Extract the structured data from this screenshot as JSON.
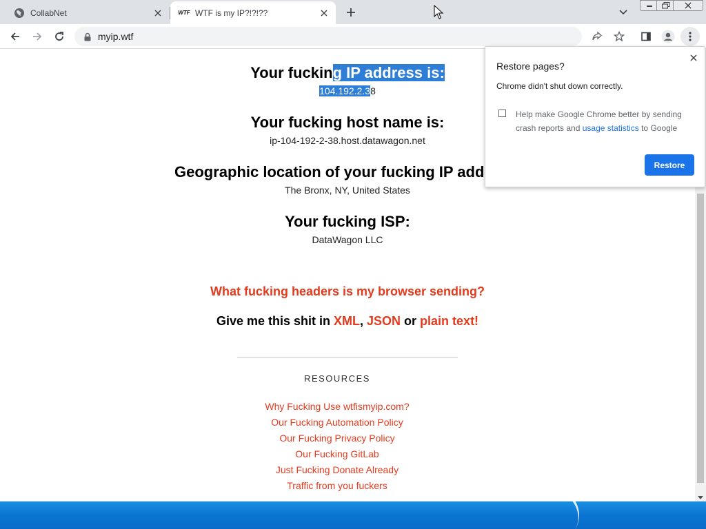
{
  "browser": {
    "tabs": [
      {
        "title": "CollabNet",
        "icon": "globe-icon"
      },
      {
        "title": "WTF is my IP?!?!??",
        "icon": "wtf-favicon",
        "favicon_text": "WTF"
      }
    ],
    "url": "myip.wtf"
  },
  "page": {
    "ip": {
      "heading_plain": "Your fuckin",
      "heading_selected": "g IP address is:",
      "value_selected": "104.192.2.3",
      "value_rest": "8"
    },
    "host": {
      "heading": "Your fucking host name is:",
      "value": "ip-104-192-2-38.host.datawagon.net"
    },
    "geo": {
      "heading": "Geographic location of your fucking IP address:",
      "value": "The Bronx, NY, United States"
    },
    "isp": {
      "heading": "Your fucking ISP:",
      "value": "DataWagon LLC"
    },
    "headers_link": "What fucking headers is my browser sending?",
    "formats": {
      "prefix": "Give me this shit in ",
      "xml": "XML",
      "comma": ", ",
      "json": "JSON",
      "or": " or ",
      "text": "plain text!"
    },
    "resources_title": "RESOURCES",
    "resources": [
      "Why Fucking Use wtfismyip.com?",
      "Our Fucking Automation Policy",
      "Our Fucking Privacy Policy",
      "Our Fucking GitLab",
      "Just Fucking Donate Already",
      "Traffic from you fuckers"
    ]
  },
  "popup": {
    "title": "Restore pages?",
    "message": "Chrome didn't shut down correctly.",
    "checkbox_before": "Help make Google Chrome better by sending crash reports and ",
    "checkbox_link": "usage statistics",
    "checkbox_after": " to Google",
    "checkbox_checked": false,
    "button": "Restore"
  },
  "colors": {
    "accent_red": "#e43a1d",
    "selection": "#2e7dd6",
    "chrome_blue": "#1a73e8"
  }
}
